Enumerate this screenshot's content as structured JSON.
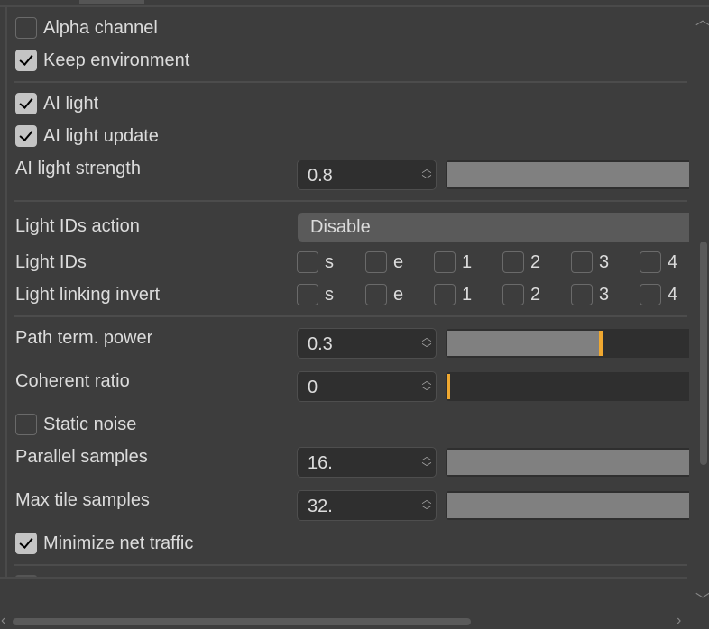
{
  "alpha_channel": {
    "label": "Alpha channel",
    "checked": false
  },
  "keep_environment": {
    "label": "Keep environment",
    "checked": true
  },
  "ai_light": {
    "label": "AI light",
    "checked": true
  },
  "ai_light_update": {
    "label": "AI light update",
    "checked": true
  },
  "ai_light_strength": {
    "label": "AI light strength",
    "value": "0.8",
    "slider_level": 1.0
  },
  "light_ids_action": {
    "label": "Light IDs action",
    "value": "Disable"
  },
  "light_ids": {
    "label": "Light IDs",
    "options": [
      "s",
      "e",
      "1",
      "2",
      "3",
      "4"
    ]
  },
  "light_linking_invert": {
    "label": "Light linking invert",
    "options": [
      "s",
      "e",
      "1",
      "2",
      "3",
      "4"
    ]
  },
  "path_term_power": {
    "label": "Path term. power",
    "value": "0.3",
    "slider_level": 0.63
  },
  "coherent_ratio": {
    "label": "Coherent ratio",
    "value": "0",
    "slider_level": 0
  },
  "static_noise": {
    "label": "Static noise",
    "checked": false
  },
  "parallel_samples": {
    "label": "Parallel samples",
    "value": "16.",
    "slider_level": 1.0
  },
  "max_tile_samples": {
    "label": "Max tile samples",
    "value": "32.",
    "slider_level": 1.0
  },
  "minimize_net_traffic": {
    "label": "Minimize net traffic",
    "checked": true
  },
  "colors": {
    "background": "#3d3d3d",
    "accent": "#f0a830",
    "slider_fill": "#808080"
  }
}
